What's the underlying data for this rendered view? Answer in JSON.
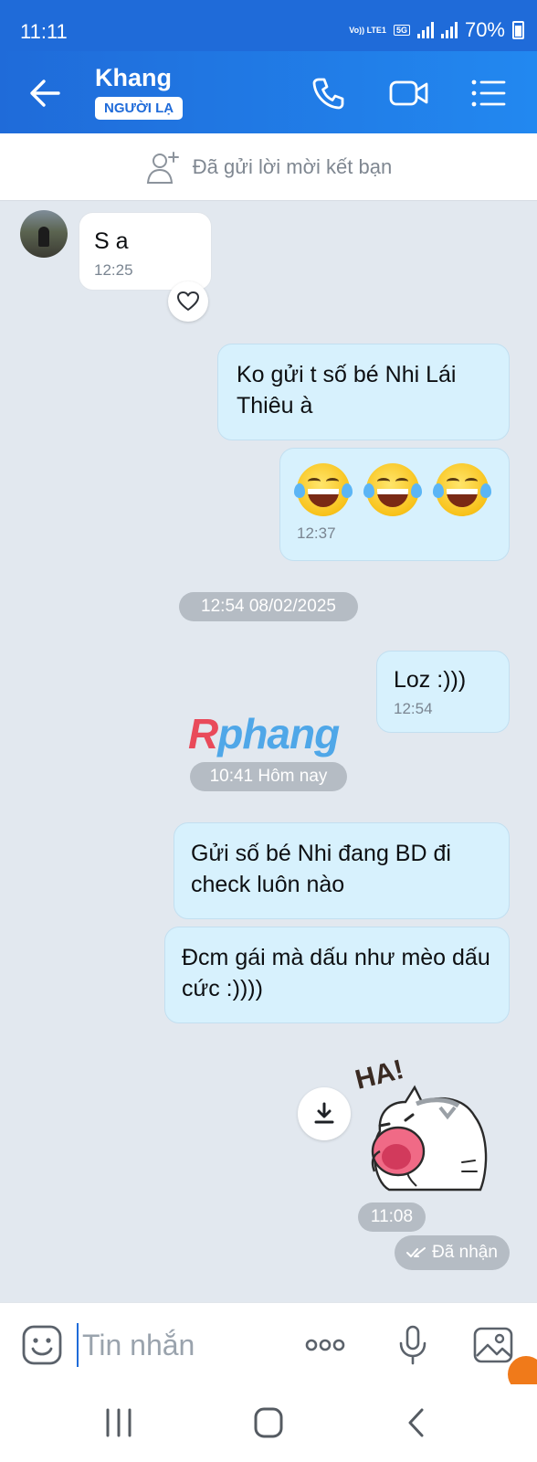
{
  "status_bar": {
    "time": "11:11",
    "network": [
      "Vo)) LTE1",
      "5G"
    ],
    "battery": "70%"
  },
  "header": {
    "title": "Khang",
    "badge": "NGƯỜI LẠ"
  },
  "friend_bar": {
    "text": "Đã gửi lời mời kết bạn"
  },
  "messages": [
    {
      "from": "them",
      "text": "S a",
      "time": "12:25"
    },
    {
      "from": "me",
      "text": "Ko gửi t số bé Nhi Lái Thiêu à"
    },
    {
      "from": "me",
      "emoji": [
        "grinning-tears",
        "grinning-tears",
        "grinning-tears"
      ],
      "time": "12:37"
    },
    {
      "from": "me",
      "text": "Loz :)))",
      "time": "12:54"
    },
    {
      "from": "me",
      "text": "Gửi số bé Nhi đang BD đi check luôn nào"
    },
    {
      "from": "me",
      "text": "Đcm gái mà dấu như mèo dấu cức :))))"
    },
    {
      "from": "me",
      "sticker": "HA!",
      "time": "11:08"
    }
  ],
  "date_separators": [
    "12:54 08/02/2025",
    "10:41 Hôm nay"
  ],
  "watermark": {
    "part1": "R",
    "part2": "phang"
  },
  "delivery_status": "Đã nhận",
  "input": {
    "placeholder": "Tin nhắn"
  },
  "colors": {
    "primary": "#1f6bd9",
    "sent_bubble": "#d7f1fd",
    "chat_bg": "#e2e8ef"
  }
}
